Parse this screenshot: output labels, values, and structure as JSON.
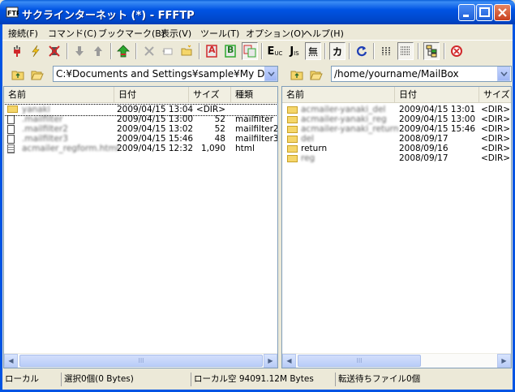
{
  "window": {
    "title": "サクラインターネット (*) - FFFTP"
  },
  "menu": [
    "接続(F)",
    "コマンド(C)",
    "ブックマーク(B)",
    "表示(V)",
    "ツール(T)",
    "オプション(O)",
    "ヘルプ(H)"
  ],
  "toolbar": {
    "ebc_label": "E",
    "ebc_sub": "UC",
    "jis_label": "J",
    "jis_sub": "IS",
    "nochange_label": "無",
    "kana_label": "カ",
    "a_label": "A",
    "b_label": "B"
  },
  "local": {
    "path": "C:¥Documents and Settings¥sample¥My Doc",
    "columns": [
      "名前",
      "日付",
      "サイズ",
      "種類"
    ],
    "rows": [
      {
        "name": "yanaki",
        "date": "2009/04/15 13:04",
        "size": "<DIR>",
        "type": "",
        "kind": "folder",
        "blur": true,
        "selected": true
      },
      {
        "name": ".mailfilter",
        "date": "2009/04/15 13:00",
        "size": "52",
        "type": "mailfilter",
        "kind": "file",
        "blur": true
      },
      {
        "name": ".mailfilter2",
        "date": "2009/04/15 13:02",
        "size": "52",
        "type": "mailfilter2",
        "kind": "file",
        "blur": true
      },
      {
        "name": ".mailfilter3",
        "date": "2009/04/15 15:46",
        "size": "48",
        "type": "mailfilter3",
        "kind": "file",
        "blur": true
      },
      {
        "name": "acmailer_regform.html",
        "date": "2009/04/15 12:32",
        "size": "1,090",
        "type": "html",
        "kind": "html",
        "blur": true
      }
    ]
  },
  "remote": {
    "path": "/home/yourname/MailBox",
    "columns": [
      "名前",
      "日付",
      "サイズ"
    ],
    "rows": [
      {
        "name": "acmailer-yanaki_del",
        "date": "2009/04/15 13:01",
        "size": "<DIR>",
        "blur": true
      },
      {
        "name": "acmailer-yanaki_reg",
        "date": "2009/04/15 13:00",
        "size": "<DIR>",
        "blur": true
      },
      {
        "name": "acmailer-yanaki_return",
        "date": "2009/04/15 15:46",
        "size": "<DIR>",
        "blur": true
      },
      {
        "name": "del",
        "date": "2008/09/17",
        "size": "<DIR>",
        "blur": true
      },
      {
        "name": "return",
        "date": "2008/09/16",
        "size": "<DIR>",
        "blur": false
      },
      {
        "name": "reg",
        "date": "2008/09/17",
        "size": "<DIR>",
        "blur": true
      }
    ]
  },
  "status": {
    "mode": "ローカル",
    "selection": "選択0個(0 Bytes)",
    "local_free": "ローカル空 94091.12M Bytes",
    "queue": "転送待ちファイル0個"
  },
  "scroll_glyph": "III"
}
